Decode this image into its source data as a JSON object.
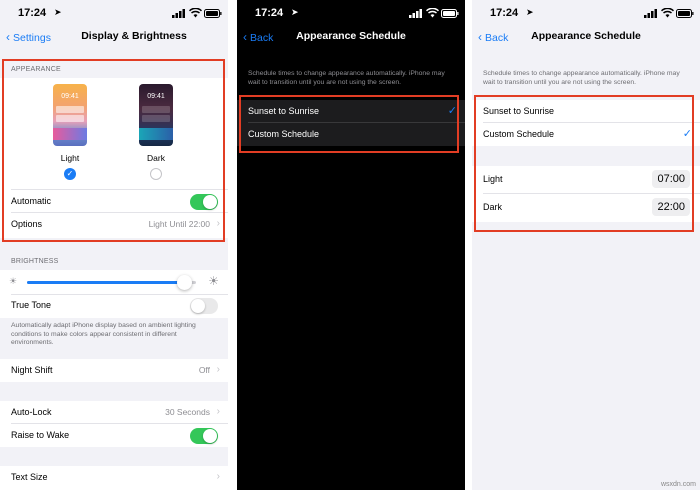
{
  "status_bar": {
    "time": "17:24"
  },
  "screen1": {
    "nav": {
      "back": "Settings",
      "title": "Display & Brightness"
    },
    "appearance": {
      "section": "APPEARANCE",
      "light": {
        "label": "Light",
        "time": "09:41"
      },
      "dark": {
        "label": "Dark",
        "time": "09:41"
      },
      "selected": "Light",
      "automatic": {
        "label": "Automatic",
        "on": true
      },
      "options": {
        "label": "Options",
        "value": "Light Until 22:00"
      }
    },
    "brightness": {
      "section": "BRIGHTNESS",
      "level": 0.93,
      "true_tone": {
        "label": "True Tone",
        "on": false
      },
      "description": "Automatically adapt iPhone display based on ambient lighting conditions to make colors appear consistent in different environments."
    },
    "night_shift": {
      "label": "Night Shift",
      "value": "Off"
    },
    "auto_lock": {
      "label": "Auto-Lock",
      "value": "30 Seconds"
    },
    "raise_to_wake": {
      "label": "Raise to Wake",
      "on": true
    },
    "text_size": {
      "label": "Text Size"
    }
  },
  "screen2": {
    "nav": {
      "back": "Back",
      "title": "Appearance Schedule"
    },
    "description": "Schedule times to change appearance automatically. iPhone may wait to transition until you are not using the screen.",
    "options": [
      {
        "label": "Sunset to Sunrise",
        "checked": true
      },
      {
        "label": "Custom Schedule",
        "checked": false
      }
    ]
  },
  "screen3": {
    "nav": {
      "back": "Back",
      "title": "Appearance Schedule"
    },
    "description": "Schedule times to change appearance automatically. iPhone may wait to transition until you are not using the screen.",
    "options": [
      {
        "label": "Sunset to Sunrise",
        "checked": false
      },
      {
        "label": "Custom Schedule",
        "checked": true
      }
    ],
    "light": {
      "label": "Light",
      "time": "07:00"
    },
    "dark": {
      "label": "Dark",
      "time": "22:00"
    }
  },
  "colors": {
    "accent": "#1a7cf5",
    "toggle_on": "#34c759",
    "highlight_box": "#e23d24"
  },
  "watermark": "wsxdn.com"
}
